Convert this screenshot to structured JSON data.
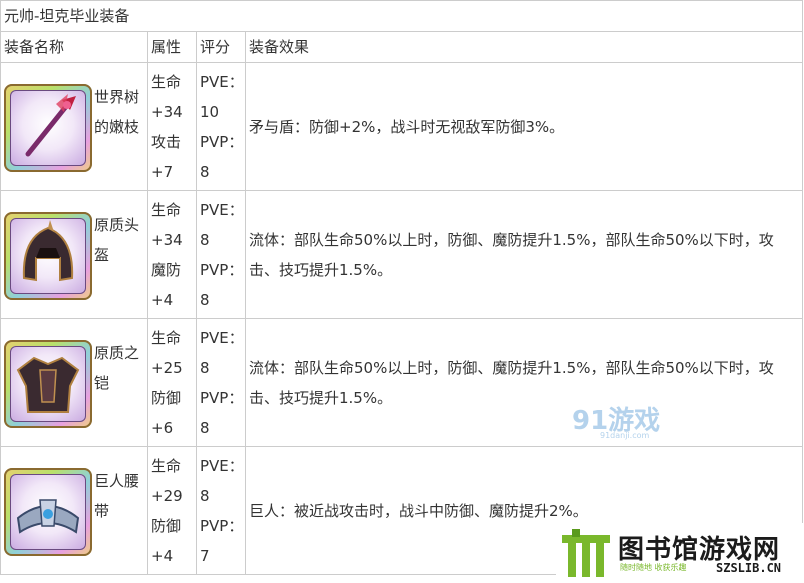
{
  "table": {
    "title": "元帅-坦克毕业装备",
    "headers": [
      "装备名称",
      "属性",
      "评分",
      "装备效果"
    ],
    "rows": [
      {
        "icon": "staff-icon",
        "name": "世界树的嫩枝",
        "stats": [
          "生命",
          "+34",
          "攻击",
          "+7"
        ],
        "score": [
          "PVE：",
          "10",
          "PVP：",
          "8"
        ],
        "effect": "矛与盾：防御+2%，战斗时无视敌军防御3%。"
      },
      {
        "icon": "helmet-icon",
        "name": "原质头盔",
        "stats": [
          "生命",
          "+34",
          "魔防",
          "+4"
        ],
        "score": [
          "PVE：",
          "8",
          "PVP：",
          "8"
        ],
        "effect": "流体：部队生命50%以上时，防御、魔防提升1.5%，部队生命50%以下时，攻击、技巧提升1.5%。"
      },
      {
        "icon": "armor-icon",
        "name": "原质之铠",
        "stats": [
          "生命",
          "+25",
          "防御",
          "+6"
        ],
        "score": [
          "PVE：",
          "8",
          "PVP：",
          "8"
        ],
        "effect": "流体：部队生命50%以上时，防御、魔防提升1.5%，部队生命50%以下时，攻击、技巧提升1.5%。"
      },
      {
        "icon": "belt-icon",
        "name": "巨人腰带",
        "stats": [
          "生命",
          "+29",
          "防御",
          "+4"
        ],
        "score": [
          "PVE：",
          "8",
          "PVP：",
          "7"
        ],
        "effect": "巨人：被近战攻击时，战斗中防御、魔防提升2%。"
      }
    ]
  },
  "watermark": {
    "text": "91游戏",
    "sub": "91danji.com"
  },
  "logo": {
    "text": "图书馆游戏网",
    "tagline": "随时随地  收获乐趣",
    "url": "SZSLIB.CN"
  }
}
